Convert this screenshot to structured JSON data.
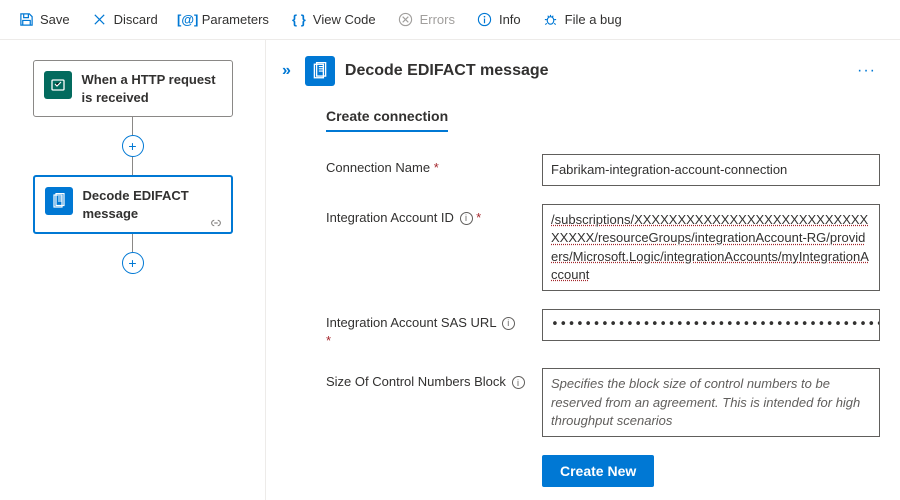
{
  "toolbar": {
    "save": "Save",
    "discard": "Discard",
    "parameters": "Parameters",
    "view_code": "View Code",
    "errors": "Errors",
    "info": "Info",
    "file_bug": "File a bug"
  },
  "canvas": {
    "node1": {
      "title": "When a HTTP request is received"
    },
    "node2": {
      "title": "Decode EDIFACT message"
    }
  },
  "panel": {
    "title": "Decode EDIFACT message",
    "section": "Create connection",
    "fields": {
      "conn_name": {
        "label": "Connection Name",
        "value": "Fabrikam-integration-account-connection"
      },
      "acct_id": {
        "label": "Integration Account ID",
        "value": "/subscriptions/XXXXXXXXXXXXXXXXXXXXXXXXXXXXXXXX/resourceGroups/integrationAccount-RG/providers/Microsoft.Logic/integrationAccounts/myIntegrationAccount"
      },
      "sas_url": {
        "label": "Integration Account SAS URL",
        "value": "•••••••••••••••••••••••••••••••••••••••••••••••••••••••••••••••••••••••••••••••••••••••••••••••••••••••••••••••••••••••••…"
      },
      "block": {
        "label": "Size Of Control Numbers Block",
        "placeholder": "Specifies the block size of control numbers to be reserved from an agreement. This is intended for high throughput scenarios"
      }
    },
    "submit": "Create New"
  }
}
